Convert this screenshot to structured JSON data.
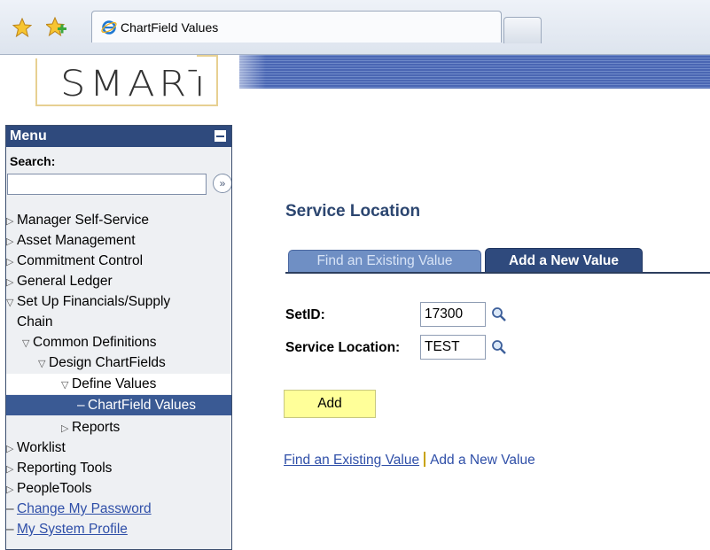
{
  "browser": {
    "tab_title": "ChartField Values"
  },
  "logo": {
    "text": "SMART"
  },
  "menu": {
    "title": "Menu",
    "search_label": "Search:",
    "search_value": "",
    "items": [
      {
        "label": "Manager Self-Service",
        "state": "closed",
        "indent": 0
      },
      {
        "label": "Asset Management",
        "state": "closed",
        "indent": 0
      },
      {
        "label": "Commitment Control",
        "state": "closed",
        "indent": 0
      },
      {
        "label": "General Ledger",
        "state": "closed",
        "indent": 0
      },
      {
        "label": "Set Up Financials/Supply",
        "state": "open",
        "indent": 0
      },
      {
        "label": "Chain",
        "state": "none",
        "indent": 0
      },
      {
        "label": "Common Definitions",
        "state": "open",
        "indent": 1
      },
      {
        "label": "Design ChartFields",
        "state": "open",
        "indent": 2
      },
      {
        "label": "Define Values",
        "state": "open",
        "indent": 3
      },
      {
        "label": "ChartField Values",
        "state": "leaf",
        "indent": 4
      },
      {
        "label": "Reports",
        "state": "closed",
        "indent": 3
      },
      {
        "label": "Worklist",
        "state": "closed",
        "indent": 0
      },
      {
        "label": "Reporting Tools",
        "state": "closed",
        "indent": 0
      },
      {
        "label": "PeopleTools",
        "state": "closed",
        "indent": 0
      },
      {
        "label": "Change My Password",
        "state": "link",
        "indent": 0
      },
      {
        "label": "My System Profile",
        "state": "link",
        "indent": 0
      }
    ]
  },
  "main": {
    "page_title": "Service Location",
    "tabs": [
      {
        "label": "Find an Existing Value",
        "active": false
      },
      {
        "label": "Add a New Value",
        "active": true
      }
    ],
    "fields": {
      "setid_label": "SetID:",
      "setid_value": "17300",
      "service_location_label": "Service Location:",
      "service_location_value": "TEST"
    },
    "add_button": "Add",
    "bottom_links": {
      "find": "Find an Existing Value",
      "add": "Add a New Value"
    }
  },
  "colors": {
    "menu_header": "#2f4a7d",
    "menu_selected": "#3a5a94",
    "title": "#2c4670",
    "link": "#2f4fa8",
    "add_button": "#ffff99"
  }
}
